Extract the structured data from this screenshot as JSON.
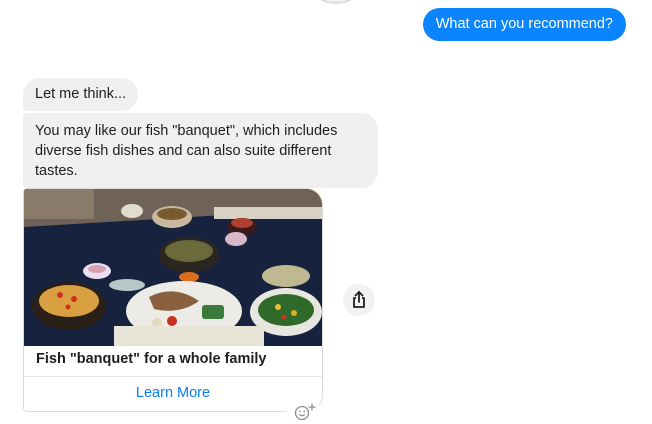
{
  "conversation": {
    "outgoing": [
      {
        "text": "What can you recommend?"
      }
    ],
    "incoming": [
      {
        "text": "Let me think..."
      },
      {
        "text": "You may like our fish \"banquet\", which includes diverse fish dishes and can also suite different tastes."
      }
    ],
    "card": {
      "title": "Fish \"banquet\" for a whole family",
      "button_label": "Learn More",
      "image_subject": "Japanese-style meal spread on a dark blue tablecloth"
    }
  },
  "icons": {
    "share": "share-icon",
    "react": "add-reaction-icon"
  },
  "colors": {
    "outgoing_bubble": "#0a84ff",
    "incoming_bubble": "#f0f0f0",
    "link": "#0a7cff"
  }
}
